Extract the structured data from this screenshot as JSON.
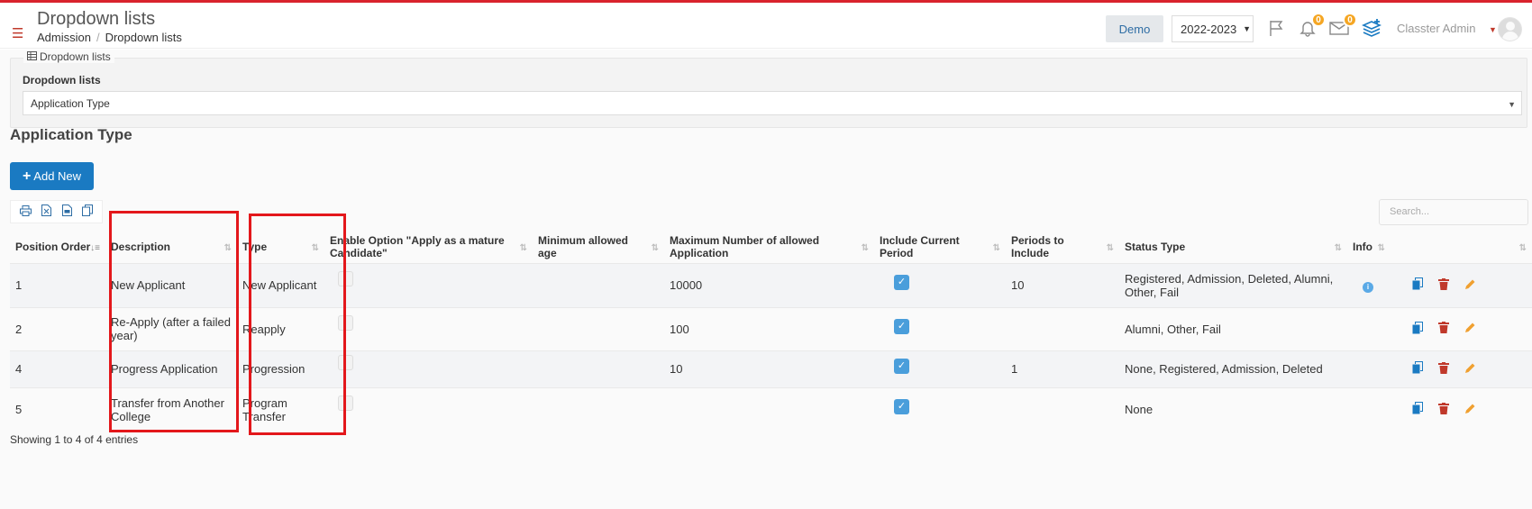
{
  "header": {
    "title": "Dropdown lists",
    "breadcrumb": [
      "Admission",
      "Dropdown lists"
    ],
    "demo_label": "Demo",
    "year": "2022-2023",
    "notifications_count": "0",
    "messages_count": "0",
    "user_name": "Classter Admin"
  },
  "filter": {
    "legend": "Dropdown lists",
    "label": "Dropdown lists",
    "selected": "Application Type"
  },
  "section": {
    "title": "Application Type",
    "add_button": "Add New",
    "search_placeholder": "Search..."
  },
  "table": {
    "columns": [
      "Position Order",
      "Description",
      "Type",
      "Enable Option \"Apply as a mature Candidate\"",
      "Minimum allowed age",
      "Maximum Number of allowed Application",
      "Include Current Period",
      "Periods to Include",
      "Status Type",
      "Info"
    ],
    "rows": [
      {
        "position": "1",
        "description": "New Applicant",
        "type": "New Applicant",
        "mature": false,
        "min_age": "",
        "max_apps": "10000",
        "include_current": true,
        "periods": "10",
        "status": "Registered, Admission, Deleted, Alumni, Other, Fail",
        "info": true
      },
      {
        "position": "2",
        "description": "Re-Apply (after a failed year)",
        "type": "Reapply",
        "mature": false,
        "min_age": "",
        "max_apps": "100",
        "include_current": true,
        "periods": "",
        "status": "Alumni, Other, Fail",
        "info": false
      },
      {
        "position": "4",
        "description": "Progress Application",
        "type": "Progression",
        "mature": false,
        "min_age": "",
        "max_apps": "10",
        "include_current": true,
        "periods": "1",
        "status": "None, Registered, Admission, Deleted",
        "info": false
      },
      {
        "position": "5",
        "description": "Transfer from Another College",
        "type": "Program Transfer",
        "mature": false,
        "min_age": "",
        "max_apps": "",
        "include_current": true,
        "periods": "",
        "status": "None",
        "info": false
      }
    ]
  },
  "footer": {
    "showing": "Showing 1 to 4 of 4 entries"
  },
  "colors": {
    "accent": "#1a7ac2",
    "highlight": "#e3171b",
    "badge": "#f5a623",
    "checkbox": "#4a9edb"
  }
}
